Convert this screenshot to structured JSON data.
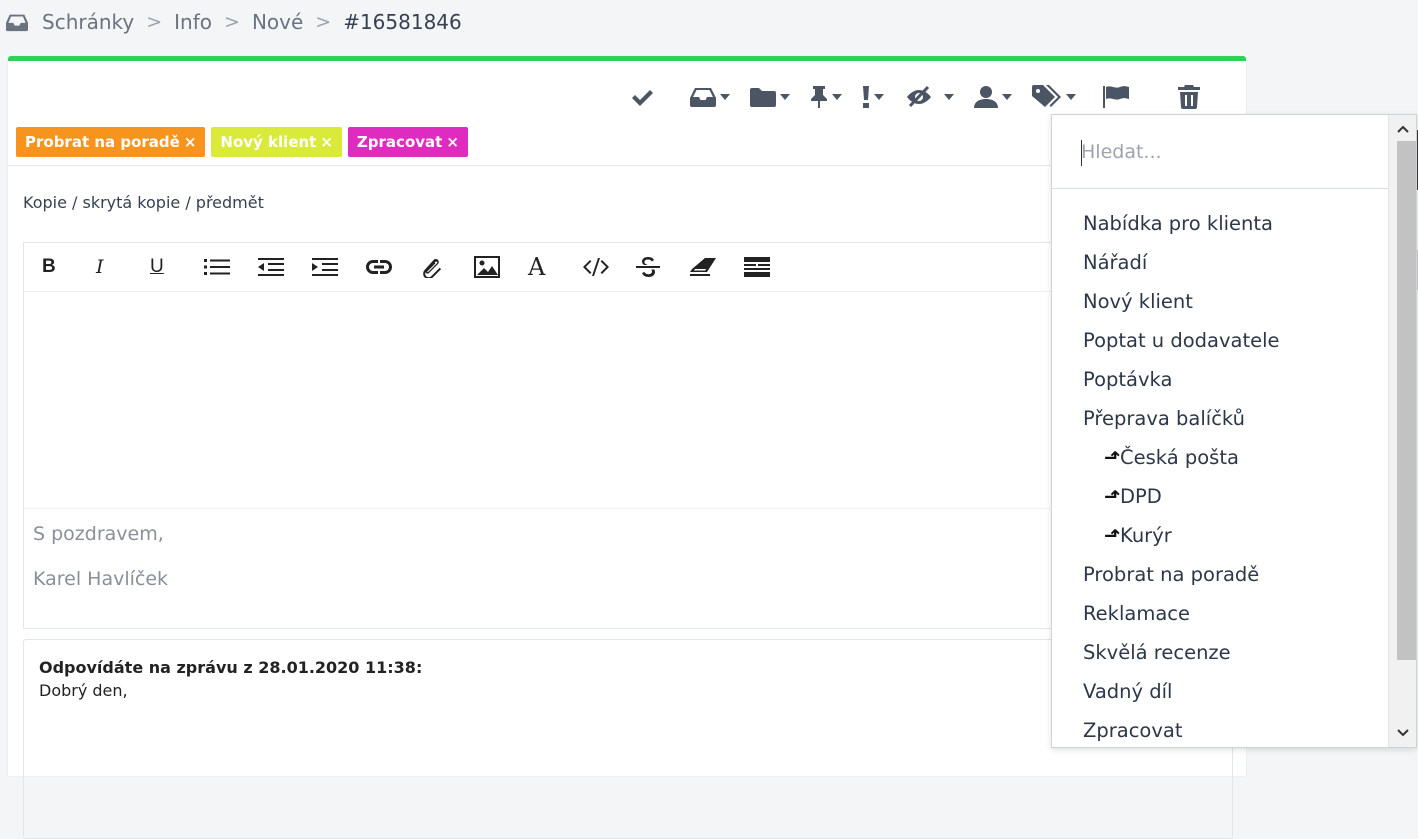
{
  "breadcrumb": {
    "items": [
      "Schránky",
      "Info",
      "Nové"
    ],
    "separator": ">",
    "current": "#16581846"
  },
  "toolbar": {
    "icons": [
      "check-icon",
      "inbox-icon",
      "folder-icon",
      "pin-icon",
      "priority-icon",
      "visibility-icon",
      "user-icon",
      "tags-icon",
      "flag-icon",
      "trash-icon"
    ]
  },
  "tags": [
    {
      "label": "Probrat na poradě",
      "remove": "×",
      "color": "#f7941d"
    },
    {
      "label": "Nový klient",
      "remove": "×",
      "color": "#d9ea3a"
    },
    {
      "label": "Zpracovat",
      "remove": "×",
      "color": "#e02bc1"
    }
  ],
  "compose": {
    "cc_link": "Kopie / skrytá kopie / předmět",
    "signature_line1": "S pozdravem,",
    "signature_line2": "Karel Havlíček"
  },
  "editor_toolbar": {
    "bold": "B",
    "italic": "I",
    "underline": "U",
    "font": "A"
  },
  "reply": {
    "header": "Odpovídáte na zprávu z 28.01.2020 11:38:",
    "body": "Dobrý den,"
  },
  "tag_dropdown": {
    "search_placeholder": "Hledat...",
    "items": [
      {
        "label": "Nabídka pro klienta",
        "sub": false
      },
      {
        "label": "Nářadí",
        "sub": false
      },
      {
        "label": "Nový klient",
        "sub": false
      },
      {
        "label": "Poptat u dodavatele",
        "sub": false
      },
      {
        "label": "Poptávka",
        "sub": false
      },
      {
        "label": "Přeprava balíčků",
        "sub": false
      },
      {
        "label": "Česká pošta",
        "sub": true
      },
      {
        "label": "DPD",
        "sub": true
      },
      {
        "label": "Kurýr",
        "sub": true
      },
      {
        "label": "Probrat na poradě",
        "sub": false
      },
      {
        "label": "Reklamace",
        "sub": false
      },
      {
        "label": "Skvělá recenze",
        "sub": false
      },
      {
        "label": "Vadný díl",
        "sub": false
      },
      {
        "label": "Zpracovat",
        "sub": false
      }
    ]
  },
  "colors": {
    "progress_bar": "#2ed255"
  }
}
